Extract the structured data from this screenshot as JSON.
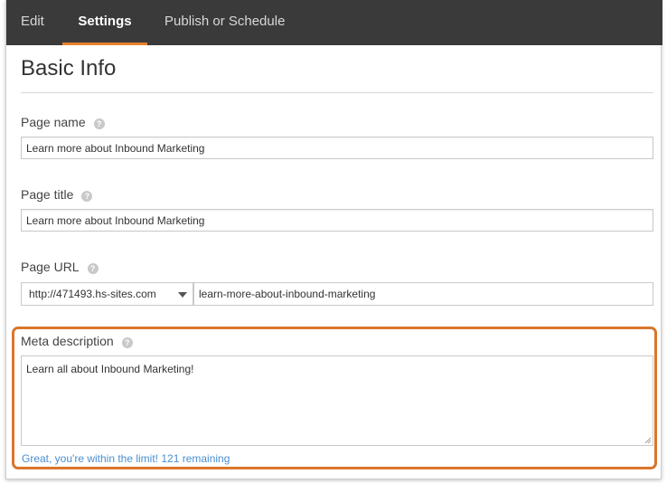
{
  "tabs": {
    "edit": "Edit",
    "settings": "Settings",
    "publish": "Publish or Schedule"
  },
  "section": {
    "title": "Basic Info"
  },
  "fields": {
    "page_name": {
      "label": "Page name",
      "value": "Learn more about Inbound Marketing"
    },
    "page_title": {
      "label": "Page title",
      "value": "Learn more about Inbound Marketing"
    },
    "page_url": {
      "label": "Page URL",
      "domain": "http://471493.hs-sites.com",
      "slug": "learn-more-about-inbound-marketing"
    },
    "meta_description": {
      "label": "Meta description",
      "value": "Learn all about Inbound Marketing!",
      "counter": "Great, you're within the limit! 121 remaining"
    }
  },
  "help_glyph": "?",
  "colors": {
    "tabbar_bg": "#3a3a3a",
    "tab_active_underline": "#e8822c",
    "highlight_border": "#d9762b",
    "counter_text": "#4a8fd0"
  },
  "icons": {
    "help": "question-circle-icon",
    "dropdown": "chevron-down-icon"
  }
}
